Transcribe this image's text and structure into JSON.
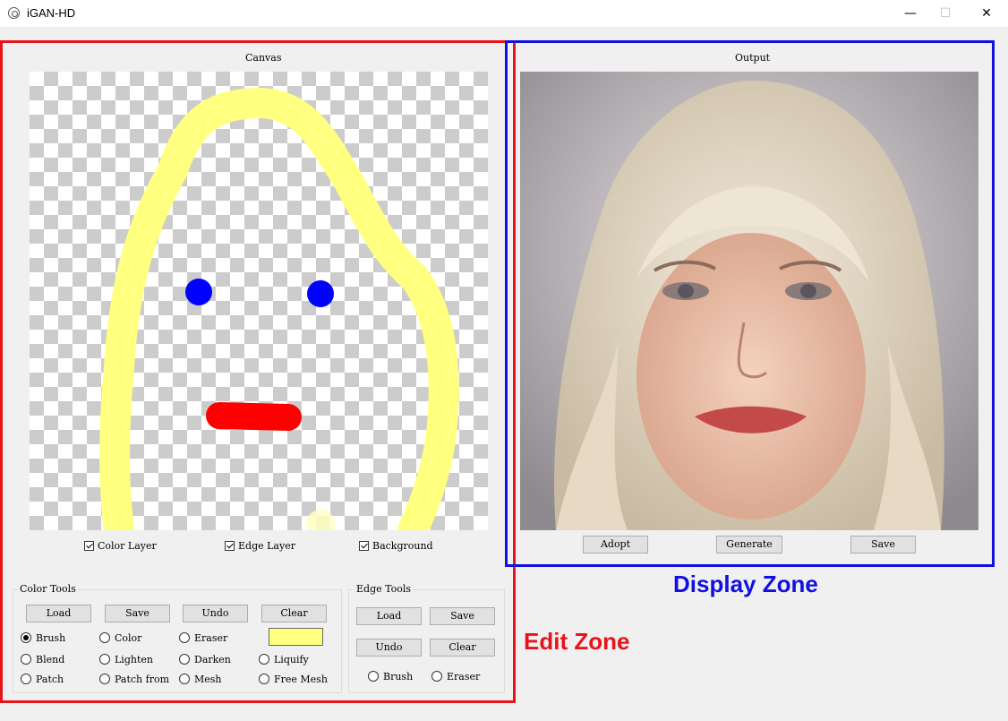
{
  "window": {
    "title": "iGAN-HD",
    "minimize": "—",
    "maximize": "☐",
    "close": "✕"
  },
  "canvas_panel": {
    "title": "Canvas",
    "checkboxes": [
      {
        "label": "Color Layer",
        "checked": true
      },
      {
        "label": "Edge Layer",
        "checked": true
      },
      {
        "label": "Background",
        "checked": true
      }
    ]
  },
  "output_panel": {
    "title": "Output",
    "buttons": [
      "Adopt",
      "Generate",
      "Save"
    ]
  },
  "color_tools": {
    "title": "Color Tools",
    "buttons": [
      "Load",
      "Save",
      "Undo",
      "Clear"
    ],
    "current_color": "#ffff80",
    "tools": [
      "Brush",
      "Color",
      "Eraser",
      "Blend",
      "Lighten",
      "Darken",
      "Liquify",
      "Patch",
      "Patch from",
      "Mesh",
      "Free Mesh"
    ],
    "selected_tool": "Brush"
  },
  "edge_tools": {
    "title": "Edge Tools",
    "buttons": [
      "Load",
      "Save",
      "Undo",
      "Clear"
    ],
    "tools": [
      "Brush",
      "Eraser"
    ]
  },
  "annotations": {
    "edit_zone": "Edit Zone",
    "display_zone": "Display Zone",
    "edit_color": "#e8141c",
    "display_color": "#1010e0"
  }
}
